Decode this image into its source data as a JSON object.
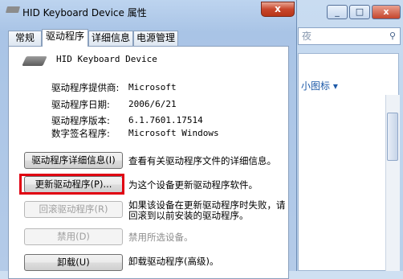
{
  "dialog": {
    "title": "HID Keyboard Device 属性",
    "close": "x",
    "tabs": [
      {
        "label": "常规"
      },
      {
        "label": "驱动程序"
      },
      {
        "label": "详细信息"
      },
      {
        "label": "电源管理"
      }
    ],
    "active_tab": "驱动程序",
    "device_name": "HID Keyboard Device",
    "properties": [
      {
        "label": "驱动程序提供商:",
        "value": "Microsoft"
      },
      {
        "label": "驱动程序日期:",
        "value": "2006/6/21"
      },
      {
        "label": "驱动程序版本:",
        "value": "6.1.7601.17514"
      },
      {
        "label": "数字签名程序:",
        "value": "Microsoft Windows"
      }
    ],
    "actions": [
      {
        "button": "驱动程序详细信息(I)",
        "desc1": "查看有关驱动程序文件的详细信息。",
        "desc2": "",
        "enabled": true
      },
      {
        "button": "更新驱动程序(P)...",
        "desc1": "为这个设备更新驱动程序软件。",
        "desc2": "",
        "enabled": true,
        "highlighted": true
      },
      {
        "button": "回滚驱动程序(R)",
        "desc1": "如果该设备在更新驱动程序时失败，请",
        "desc2": "回滚到以前安装的驱动程序。",
        "enabled": false
      },
      {
        "button": "禁用(D)",
        "desc1": "禁用所选设备。",
        "desc2": "",
        "enabled": false
      },
      {
        "button": "卸载(U)",
        "desc1": "卸载驱动程序(高级)。",
        "desc2": "",
        "enabled": true
      }
    ],
    "highlight_color": "#e00012"
  },
  "background_window": {
    "minimize": "_",
    "maximize": "□",
    "close": "x",
    "search_placeholder": "夜",
    "view_label": "小图标 ▾"
  }
}
